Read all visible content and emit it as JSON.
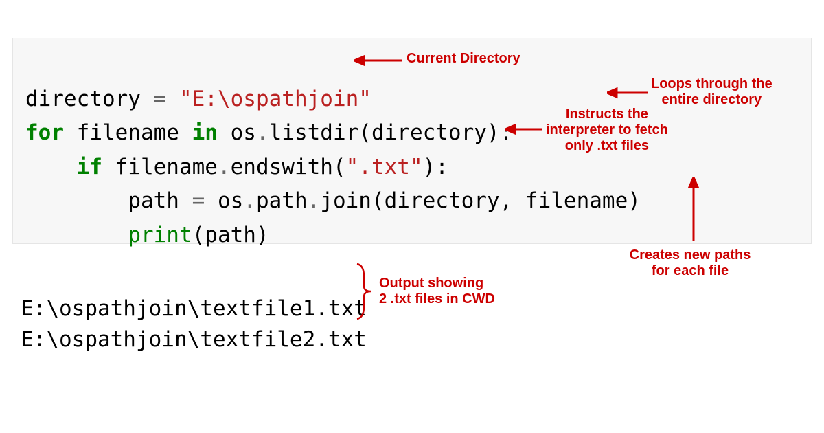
{
  "code": {
    "line1": {
      "t1": "directory ",
      "op": "=",
      "t2": " ",
      "str": "\"E:\\ospathjoin\""
    },
    "line2": {
      "kw1": "for",
      "t1": " filename ",
      "kw2": "in",
      "t2": " os",
      "op": ".",
      "t3": "listdir(directory):"
    },
    "line3": {
      "indent": "    ",
      "kw": "if",
      "t1": " filename",
      "op1": ".",
      "t2": "endswith(",
      "str": "\".txt\"",
      "t3": "):"
    },
    "line4": {
      "indent": "        ",
      "t1": "path ",
      "op1": "=",
      "t2": " os",
      "op2": ".",
      "t3": "path",
      "op3": ".",
      "t4": "join(directory, filename)"
    },
    "line5": {
      "indent": "        ",
      "builtin": "print",
      "t1": "(path)"
    }
  },
  "output": {
    "line1": "E:\\ospathjoin\\textfile1.txt",
    "line2": "E:\\ospathjoin\\textfile2.txt"
  },
  "annotations": {
    "current_dir": "Current Directory",
    "loop1": "Loops through the",
    "loop2": "entire directory",
    "fetch1": "Instructs the",
    "fetch2": "interpreter to fetch",
    "fetch3": "only .txt files",
    "newpaths1": "Creates new paths",
    "newpaths2": "for each file",
    "output1": "Output showing",
    "output2": "2 .txt files in CWD"
  },
  "colors": {
    "annotation": "#cc0000",
    "keyword": "#008000",
    "string": "#BA2121",
    "code_bg": "#f7f7f7"
  }
}
